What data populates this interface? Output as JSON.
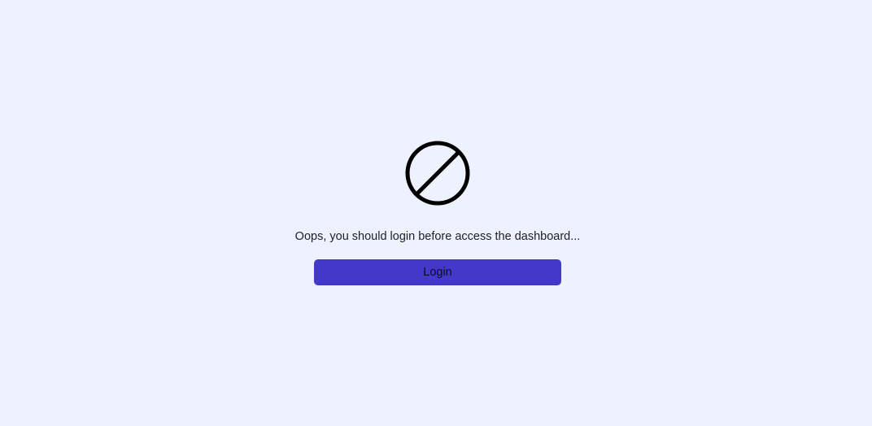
{
  "icon": {
    "name": "block-icon"
  },
  "message": "Oops, you should login before access the dashboard...",
  "login_button": {
    "label": "Login"
  },
  "colors": {
    "background": "#eef2fe",
    "button": "#4338ca",
    "icon": "#000000",
    "text": "#1e1e2a"
  }
}
